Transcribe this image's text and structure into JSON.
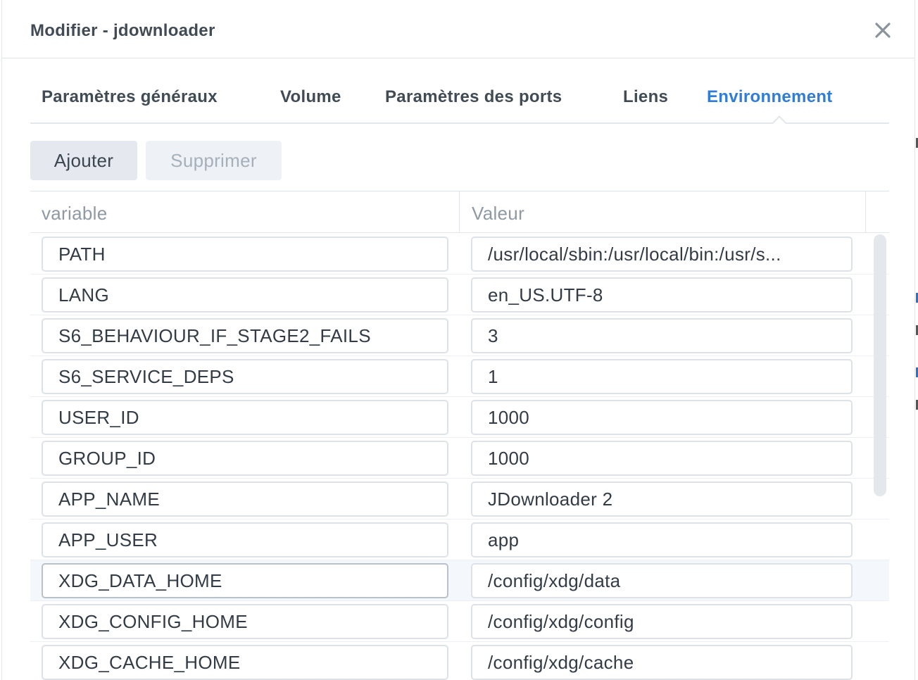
{
  "dialog": {
    "title": "Modifier - jdownloader",
    "close_glyph": "close-icon"
  },
  "tabs": [
    {
      "label": "Paramètres généraux",
      "active": false
    },
    {
      "label": "Volume",
      "active": false
    },
    {
      "label": "Paramètres des ports",
      "active": false
    },
    {
      "label": "Liens",
      "active": false
    },
    {
      "label": "Environnement",
      "active": true
    }
  ],
  "toolbar": {
    "add_label": "Ajouter",
    "delete_label": "Supprimer",
    "delete_disabled": true
  },
  "grid": {
    "columns": [
      "variable",
      "Valeur"
    ],
    "rows": [
      {
        "variable": "PATH",
        "value": "/usr/local/sbin:/usr/local/bin:/usr/s..."
      },
      {
        "variable": "LANG",
        "value": "en_US.UTF-8"
      },
      {
        "variable": "S6_BEHAVIOUR_IF_STAGE2_FAILS",
        "value": "3"
      },
      {
        "variable": "S6_SERVICE_DEPS",
        "value": "1"
      },
      {
        "variable": "USER_ID",
        "value": "1000"
      },
      {
        "variable": "GROUP_ID",
        "value": "1000"
      },
      {
        "variable": "APP_NAME",
        "value": "JDownloader 2"
      },
      {
        "variable": "APP_USER",
        "value": "app"
      },
      {
        "variable": "XDG_DATA_HOME",
        "value": "/config/xdg/data",
        "highlighted": true
      },
      {
        "variable": "XDG_CONFIG_HOME",
        "value": "/config/xdg/config"
      },
      {
        "variable": "XDG_CACHE_HOME",
        "value": "/config/xdg/cache"
      }
    ]
  },
  "colors": {
    "accent": "#2f7dd8",
    "text": "#414b55",
    "muted": "#8f99a4"
  }
}
